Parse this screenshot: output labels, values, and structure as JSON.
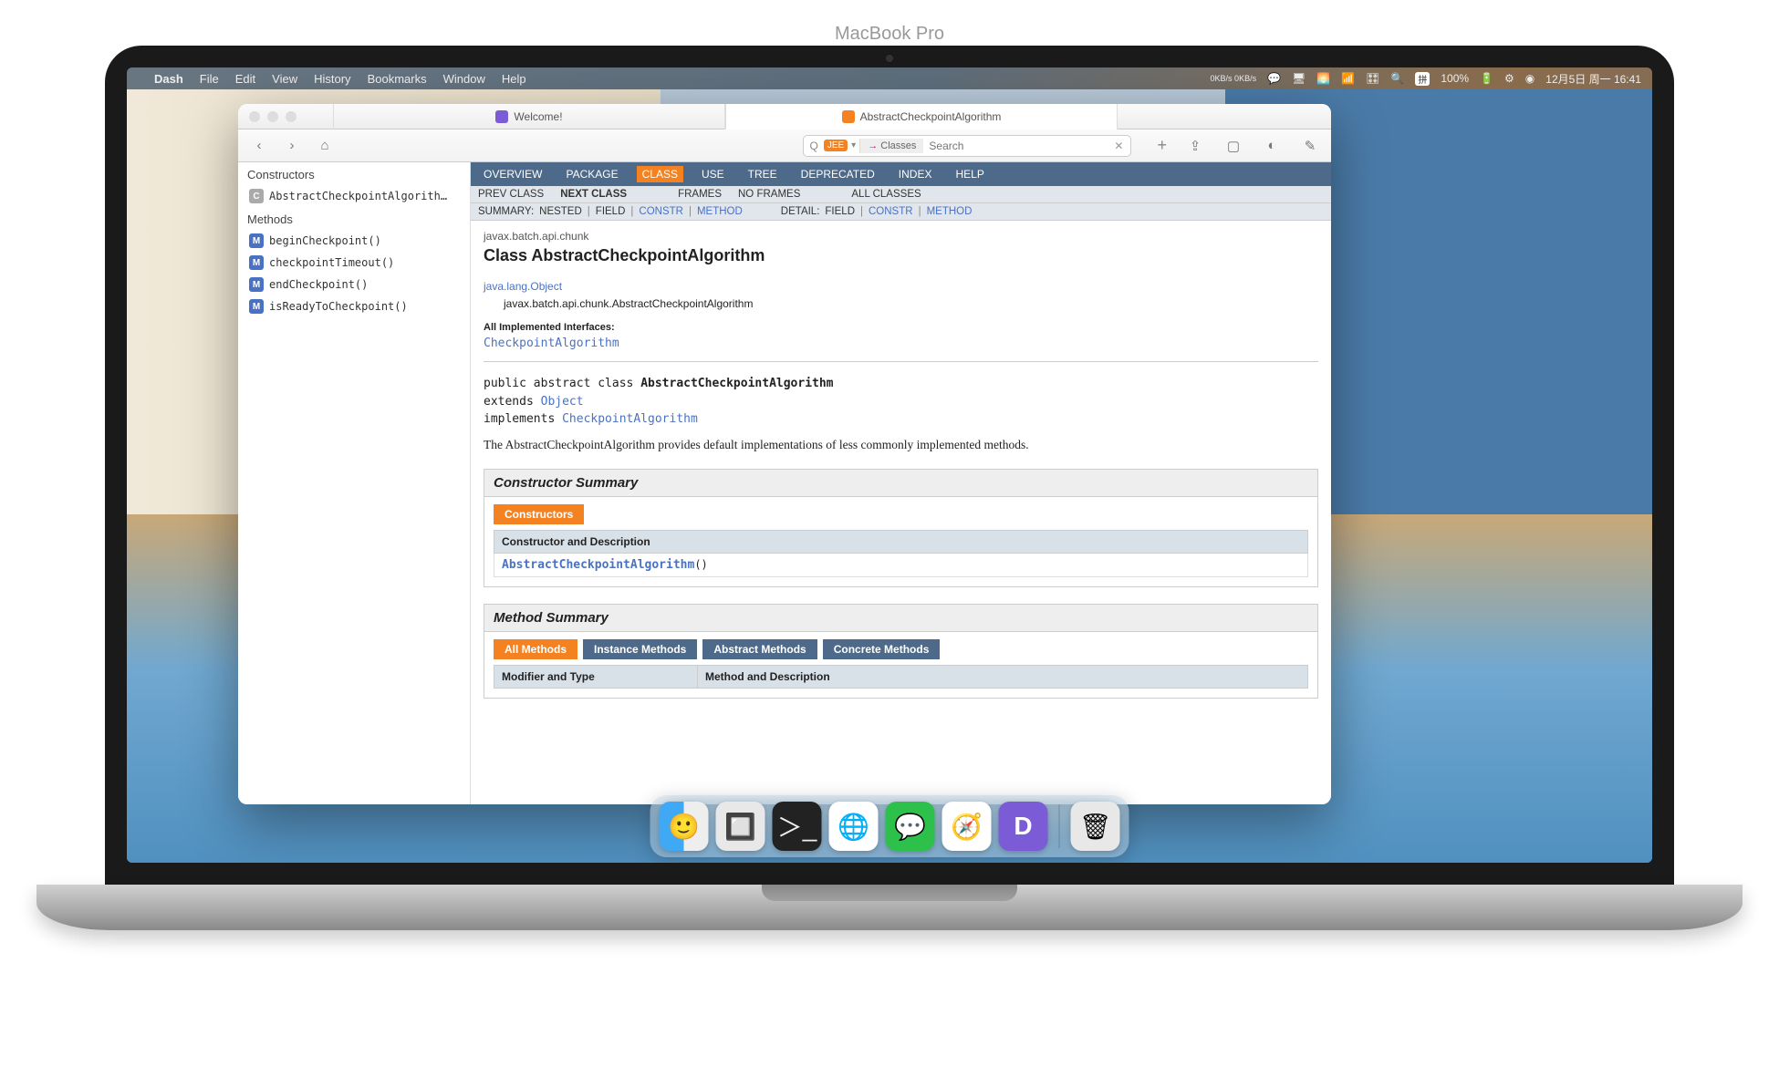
{
  "menubar": {
    "app": "Dash",
    "items": [
      "File",
      "Edit",
      "View",
      "History",
      "Bookmarks",
      "Window",
      "Help"
    ],
    "net": "0KB/s 0KB/s",
    "battery": "100%",
    "ime": "拼",
    "date": "12月5日 周一 16:41"
  },
  "window": {
    "tabs": [
      {
        "label": "Welcome!",
        "active": false,
        "icon": "d"
      },
      {
        "label": "AbstractCheckpointAlgorithm",
        "active": true,
        "icon": "j"
      }
    ],
    "toolbar": {
      "search_placeholder": "Search",
      "classes_label": "Classes"
    }
  },
  "sidebar": {
    "sections": [
      {
        "title": "Constructors",
        "items": [
          {
            "badge": "C",
            "label": "AbstractCheckpointAlgorith…"
          }
        ]
      },
      {
        "title": "Methods",
        "items": [
          {
            "badge": "M",
            "label": "beginCheckpoint()"
          },
          {
            "badge": "M",
            "label": "checkpointTimeout()"
          },
          {
            "badge": "M",
            "label": "endCheckpoint()"
          },
          {
            "badge": "M",
            "label": "isReadyToCheckpoint()"
          }
        ]
      }
    ]
  },
  "content": {
    "nav1": [
      "OVERVIEW",
      "PACKAGE",
      "CLASS",
      "USE",
      "TREE",
      "DEPRECATED",
      "INDEX",
      "HELP"
    ],
    "nav1_active": "CLASS",
    "nav2": {
      "prev": "PREV CLASS",
      "next": "NEXT CLASS",
      "frames": "FRAMES",
      "noframes": "NO FRAMES",
      "all": "ALL CLASSES"
    },
    "nav3": {
      "summary_label": "SUMMARY:",
      "summary_items": [
        "NESTED",
        "FIELD",
        "CONSTR",
        "METHOD"
      ],
      "detail_label": "DETAIL:",
      "detail_items": [
        "FIELD",
        "CONSTR",
        "METHOD"
      ]
    },
    "package": "javax.batch.api.chunk",
    "class_title": "Class AbstractCheckpointAlgorithm",
    "inherit_parent": "java.lang.Object",
    "inherit_self": "javax.batch.api.chunk.AbstractCheckpointAlgorithm",
    "impl_label": "All Implemented Interfaces:",
    "impl_link": "CheckpointAlgorithm",
    "sig_pre": "public abstract class ",
    "sig_name": "AbstractCheckpointAlgorithm",
    "sig_ext": "extends ",
    "sig_ext_type": "Object",
    "sig_impl": "implements ",
    "sig_impl_type": "CheckpointAlgorithm",
    "description": "The AbstractCheckpointAlgorithm provides default implementations of less commonly implemented methods.",
    "constructor_summary": {
      "title": "Constructor Summary",
      "pill": "Constructors",
      "col": "Constructor and Description",
      "row_name": "AbstractCheckpointAlgorithm",
      "row_paren": "()"
    },
    "method_summary": {
      "title": "Method Summary",
      "pills": [
        "All Methods",
        "Instance Methods",
        "Abstract Methods",
        "Concrete Methods"
      ],
      "cols": [
        "Modifier and Type",
        "Method and Description"
      ]
    }
  },
  "base": {
    "label": "MacBook Pro"
  }
}
